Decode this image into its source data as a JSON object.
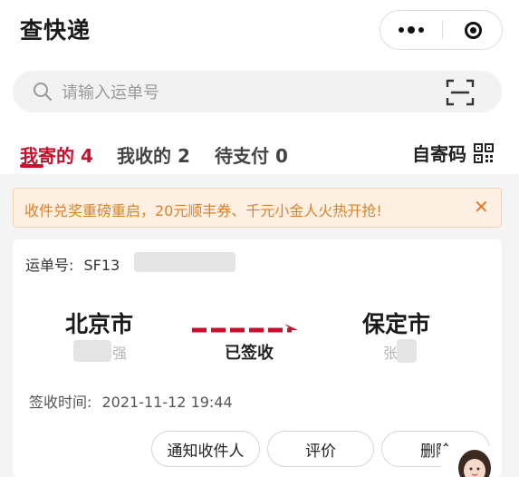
{
  "header": {
    "title": "查快递"
  },
  "search": {
    "placeholder": "请输入运单号"
  },
  "tabs": [
    {
      "label": "我寄的 4",
      "active": true
    },
    {
      "label": "我收的 2",
      "active": false
    },
    {
      "label": "待支付 0",
      "active": false
    }
  ],
  "qr_link": {
    "label": "自寄码"
  },
  "notice": {
    "text": "收件兑奖重磅重启，20元顺丰券、千元小金人火热开抢!"
  },
  "shipment": {
    "waybill_label": "运单号:",
    "waybill_prefix": "SF13",
    "origin_city": "北京市",
    "origin_person": "强",
    "status": "已签收",
    "dest_city": "保定市",
    "dest_person": "张",
    "sign_time_label": "签收时间:",
    "sign_time": "2021-11-12 19:44",
    "actions": {
      "notify": "通知收件人",
      "review": "评价",
      "delete": "删除"
    }
  },
  "colors": {
    "accent": "#c8102e",
    "notice_text": "#d9822b",
    "notice_bg": "#fdf0e2"
  }
}
